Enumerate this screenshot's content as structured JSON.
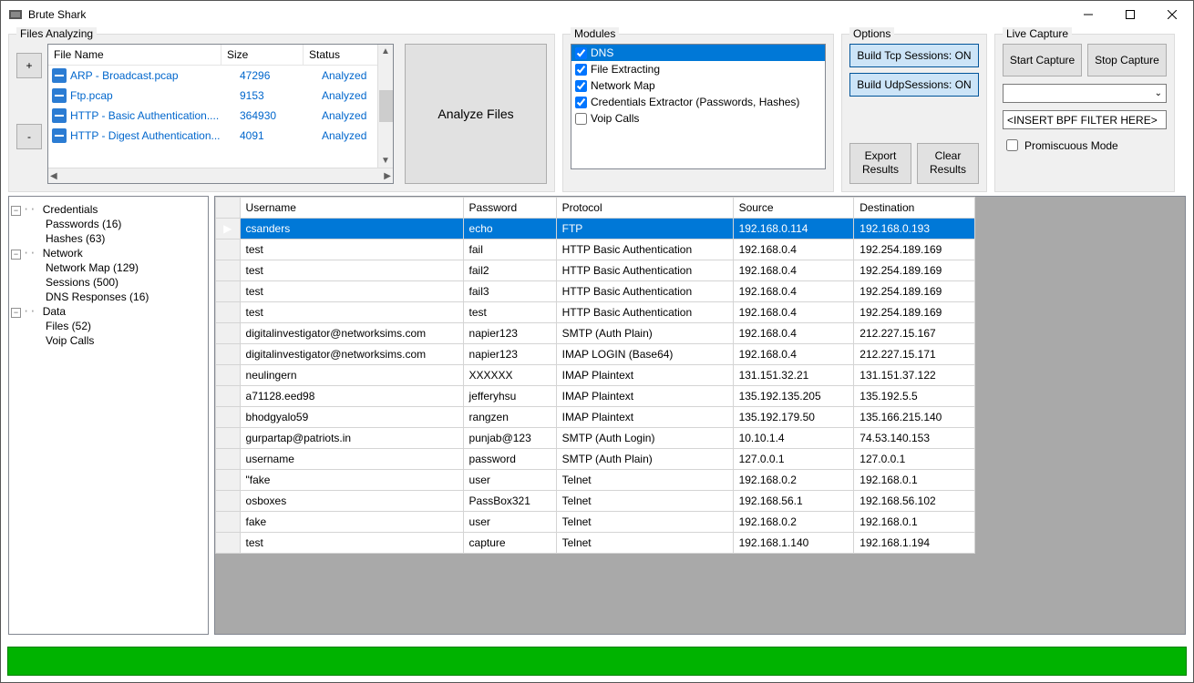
{
  "window": {
    "title": "Brute Shark"
  },
  "filesGroup": {
    "legend": "Files Analyzing",
    "plus": "+",
    "minus": "-",
    "headers": {
      "name": "File Name",
      "size": "Size",
      "status": "Status"
    },
    "rows": [
      {
        "name": "ARP - Broadcast.pcap",
        "size": "47296",
        "status": "Analyzed"
      },
      {
        "name": "Ftp.pcap",
        "size": "9153",
        "status": "Analyzed"
      },
      {
        "name": "HTTP - Basic Authentication....",
        "size": "364930",
        "status": "Analyzed"
      },
      {
        "name": "HTTP - Digest Authentication...",
        "size": "4091",
        "status": "Analyzed"
      }
    ],
    "analyzeBtn": "Analyze Files"
  },
  "modulesGroup": {
    "legend": "Modules",
    "items": [
      {
        "label": "DNS",
        "checked": true,
        "selected": true
      },
      {
        "label": "File Extracting",
        "checked": true
      },
      {
        "label": "Network Map",
        "checked": true
      },
      {
        "label": "Credentials Extractor (Passwords, Hashes)",
        "checked": true
      },
      {
        "label": "Voip Calls",
        "checked": false
      }
    ]
  },
  "optionsGroup": {
    "legend": "Options",
    "tcp": "Build Tcp Sessions: ON",
    "udp": "Build UdpSessions: ON",
    "export": "Export Results",
    "clear": "Clear Results"
  },
  "captureGroup": {
    "legend": "Live Capture",
    "start": "Start Capture",
    "stop": "Stop Capture",
    "filterPlaceholder": "<INSERT BPF FILTER HERE>",
    "promiscuous": "Promiscuous Mode"
  },
  "tree": {
    "credentials": "Credentials",
    "passwords": "Passwords (16)",
    "hashes": "Hashes (63)",
    "network": "Network",
    "networkMap": "Network Map (129)",
    "sessions": "Sessions (500)",
    "dns": "DNS Responses (16)",
    "data": "Data",
    "files": "Files (52)",
    "voip": "Voip Calls"
  },
  "grid": {
    "headers": {
      "user": "Username",
      "pass": "Password",
      "proto": "Protocol",
      "src": "Source",
      "dst": "Destination"
    },
    "rows": [
      {
        "user": "csanders",
        "pass": "echo",
        "proto": "FTP",
        "src": "192.168.0.114",
        "dst": "192.168.0.193",
        "selected": true
      },
      {
        "user": "test",
        "pass": "fail",
        "proto": "HTTP Basic Authentication",
        "src": "192.168.0.4",
        "dst": "192.254.189.169"
      },
      {
        "user": "test",
        "pass": "fail2",
        "proto": "HTTP Basic Authentication",
        "src": "192.168.0.4",
        "dst": "192.254.189.169"
      },
      {
        "user": "test",
        "pass": "fail3",
        "proto": "HTTP Basic Authentication",
        "src": "192.168.0.4",
        "dst": "192.254.189.169"
      },
      {
        "user": "test",
        "pass": "test",
        "proto": "HTTP Basic Authentication",
        "src": "192.168.0.4",
        "dst": "192.254.189.169"
      },
      {
        "user": "digitalinvestigator@networksims.com",
        "pass": "napier123",
        "proto": "SMTP (Auth Plain)",
        "src": "192.168.0.4",
        "dst": "212.227.15.167"
      },
      {
        "user": "digitalinvestigator@networksims.com",
        "pass": "napier123",
        "proto": "IMAP LOGIN (Base64)",
        "src": "192.168.0.4",
        "dst": "212.227.15.171"
      },
      {
        "user": "neulingern",
        "pass": "XXXXXX",
        "proto": "IMAP Plaintext",
        "src": "131.151.32.21",
        "dst": "131.151.37.122"
      },
      {
        "user": "a71128.eed98",
        "pass": "jefferyhsu",
        "proto": "IMAP Plaintext",
        "src": "135.192.135.205",
        "dst": "135.192.5.5"
      },
      {
        "user": "bhodgyalo59",
        "pass": "rangzen",
        "proto": "IMAP Plaintext",
        "src": "135.192.179.50",
        "dst": "135.166.215.140"
      },
      {
        "user": "gurpartap@patriots.in",
        "pass": "punjab@123",
        "proto": "SMTP (Auth Login)",
        "src": "10.10.1.4",
        "dst": "74.53.140.153"
      },
      {
        "user": "username",
        "pass": "password",
        "proto": "SMTP (Auth Plain)",
        "src": "127.0.0.1",
        "dst": "127.0.0.1"
      },
      {
        "user": "\"fake",
        "pass": "user",
        "proto": "Telnet",
        "src": "192.168.0.2",
        "dst": "192.168.0.1"
      },
      {
        "user": "osboxes",
        "pass": "PassBox321",
        "proto": "Telnet",
        "src": "192.168.56.1",
        "dst": "192.168.56.102"
      },
      {
        "user": "fake",
        "pass": "user",
        "proto": "Telnet",
        "src": "192.168.0.2",
        "dst": "192.168.0.1"
      },
      {
        "user": "test",
        "pass": "capture",
        "proto": "Telnet",
        "src": "192.168.1.140",
        "dst": "192.168.1.194"
      }
    ]
  }
}
